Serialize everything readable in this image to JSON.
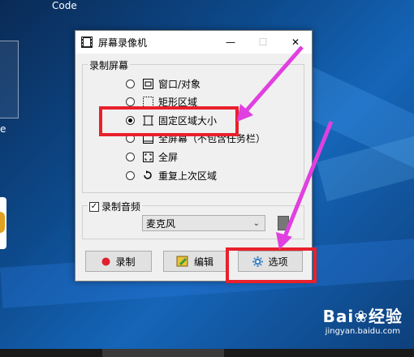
{
  "desktop": {
    "code_label": "Code",
    "edge_char": "e"
  },
  "window": {
    "title": "屏幕录像机",
    "min_symbol": "—",
    "max_symbol": "☐",
    "close_symbol": "✕"
  },
  "record_screen": {
    "label": "录制屏幕",
    "options": [
      {
        "label": "窗口/对象",
        "icon": "window-object-icon",
        "selected": false
      },
      {
        "label": "矩形区域",
        "icon": "rectangle-region-icon",
        "selected": false
      },
      {
        "label": "固定区域大小",
        "icon": "fixed-region-icon",
        "selected": true
      },
      {
        "label": "全屏幕（不包含任务栏）",
        "icon": "fullscreen-no-taskbar-icon",
        "selected": false
      },
      {
        "label": "全屏",
        "icon": "fullscreen-icon",
        "selected": false
      },
      {
        "label": "重复上次区域",
        "icon": "repeat-region-icon",
        "selected": false
      }
    ]
  },
  "audio": {
    "label": "录制音频",
    "checked": true,
    "check_symbol": "✓",
    "device": "麦克风"
  },
  "buttons": {
    "record": "录制",
    "edit": "编辑",
    "options": "选项"
  },
  "watermark": {
    "brand": "Bai❀经验",
    "url": "jingyan.baidu.com"
  },
  "colors": {
    "highlight_red": "#e8212b",
    "arrow_magenta": "#e040e0"
  }
}
